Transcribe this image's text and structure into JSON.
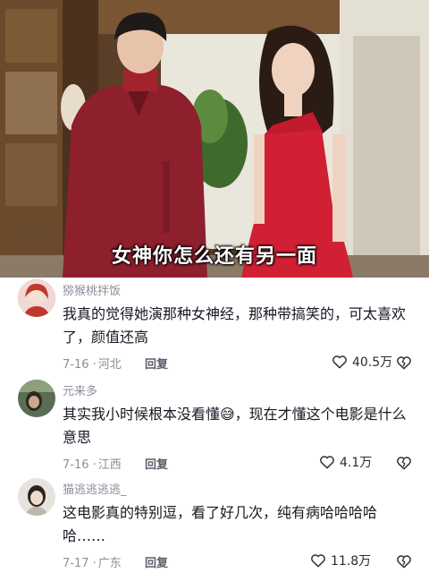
{
  "video": {
    "subtitle": "女神你怎么还有另一面"
  },
  "comments": [
    {
      "username": "猕猴桃拌饭",
      "text": "我真的觉得她演那种女神经，那种带搞笑的，可太喜欢了，颜值还高",
      "date": "7-16",
      "location": "河北",
      "reply_label": "回复",
      "likes": "40.5万",
      "avatar_color": "#c94a4a"
    },
    {
      "username": "元来多",
      "text": "其实我小时候根本没看懂😅，现在才懂这个电影是什么意思",
      "date": "7-16",
      "location": "江西",
      "reply_label": "回复",
      "likes": "4.1万",
      "avatar_color": "#5b6d52"
    },
    {
      "username": "猫逃逃逃逃_",
      "text": "这电影真的特别逗，看了好几次，纯有病哈哈哈哈哈……",
      "date": "7-17",
      "location": "广东",
      "reply_label": "回复",
      "likes": "11.8万",
      "avatar_color": "#d9d6d2"
    }
  ],
  "icons": {
    "like": "heart-outline-icon",
    "dislike": "broken-heart-icon"
  }
}
